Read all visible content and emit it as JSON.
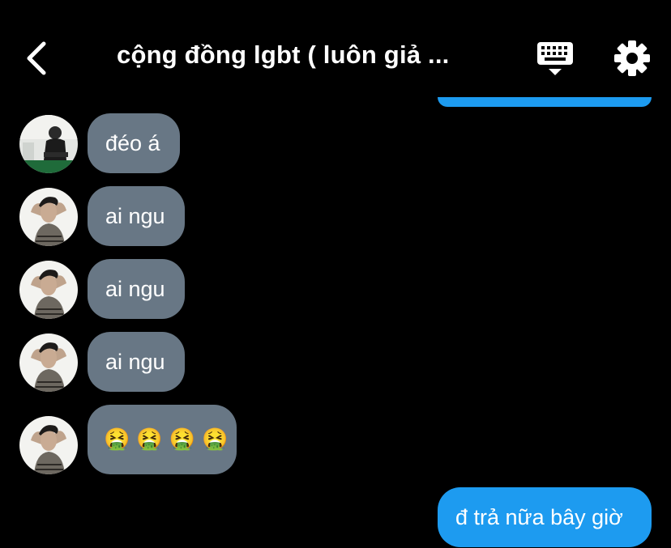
{
  "header": {
    "title": "cộng đồng lgbt ( luôn giả ...",
    "back_icon": "chevron-left-icon",
    "keyboard_icon": "keyboard-icon",
    "settings_icon": "gear-icon"
  },
  "colors": {
    "background": "#000000",
    "incoming_bubble": "#687785",
    "outgoing_bubble": "#1d9bf0",
    "text": "#ffffff"
  },
  "messages": [
    {
      "direction": "incoming",
      "text": "đéo á",
      "avatar": "avatar-user-1"
    },
    {
      "direction": "incoming",
      "text": "ai ngu",
      "avatar": "avatar-user-2"
    },
    {
      "direction": "incoming",
      "text": "ai ngu",
      "avatar": "avatar-user-2"
    },
    {
      "direction": "incoming",
      "text": "ai ngu",
      "avatar": "avatar-user-2"
    },
    {
      "direction": "incoming",
      "text": "🤮🤮🤮🤮",
      "avatar": "avatar-user-2"
    },
    {
      "direction": "outgoing",
      "text": "đ trả nữa bây giờ"
    }
  ]
}
